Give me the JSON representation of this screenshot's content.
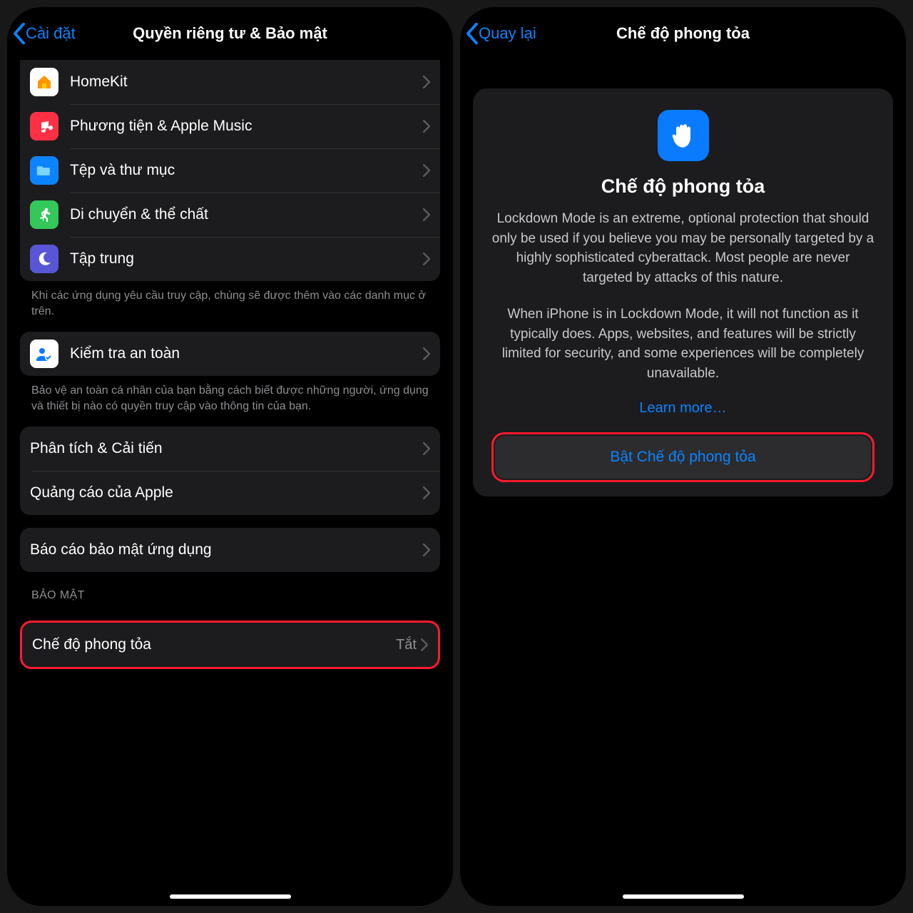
{
  "left": {
    "back": "Cài đặt",
    "title": "Quyền riêng tư & Bảo mật",
    "group1": [
      {
        "label": "HomeKit",
        "icon": "homekit",
        "bg": "#ffffff"
      },
      {
        "label": "Phương tiện & Apple Music",
        "icon": "music",
        "bg": "#ff3044"
      },
      {
        "label": "Tệp và thư mục",
        "icon": "folder",
        "bg": "#0d84ff"
      },
      {
        "label": "Di chuyển & thể chất",
        "icon": "fitness",
        "bg": "#34c759"
      },
      {
        "label": "Tập trung",
        "icon": "moon",
        "bg": "#5856d6"
      }
    ],
    "note1": "Khi các ứng dụng yêu cầu truy cập, chúng sẽ được thêm vào các danh mục ở trên.",
    "safety": {
      "label": "Kiểm tra an toàn"
    },
    "note2": "Bảo vệ an toàn cá nhân của bạn bằng cách biết được những người, ứng dụng và thiết bị nào có quyền truy cập vào thông tin của bạn.",
    "group3": [
      {
        "label": "Phân tích & Cải tiến"
      },
      {
        "label": "Quảng cáo của Apple"
      }
    ],
    "group4": [
      {
        "label": "Báo cáo bảo mật ứng dụng"
      }
    ],
    "section_security": "BẢO MẬT",
    "lockdown": {
      "label": "Chế độ phong tỏa",
      "value": "Tắt"
    }
  },
  "right": {
    "back": "Quay lại",
    "title": "Chế độ phong tỏa",
    "card_title": "Chế độ phong tỏa",
    "p1": "Lockdown Mode is an extreme, optional protection that should only be used if you believe you may be personally targeted by a highly sophisticated cyberattack. Most people are never targeted by attacks of this nature.",
    "p2": "When iPhone is in Lockdown Mode, it will not function as it typically does. Apps, websites, and features will be strictly limited for security, and some experiences will be completely unavailable.",
    "learn": "Learn more…",
    "enable": "Bật Chế độ phong tỏa"
  }
}
